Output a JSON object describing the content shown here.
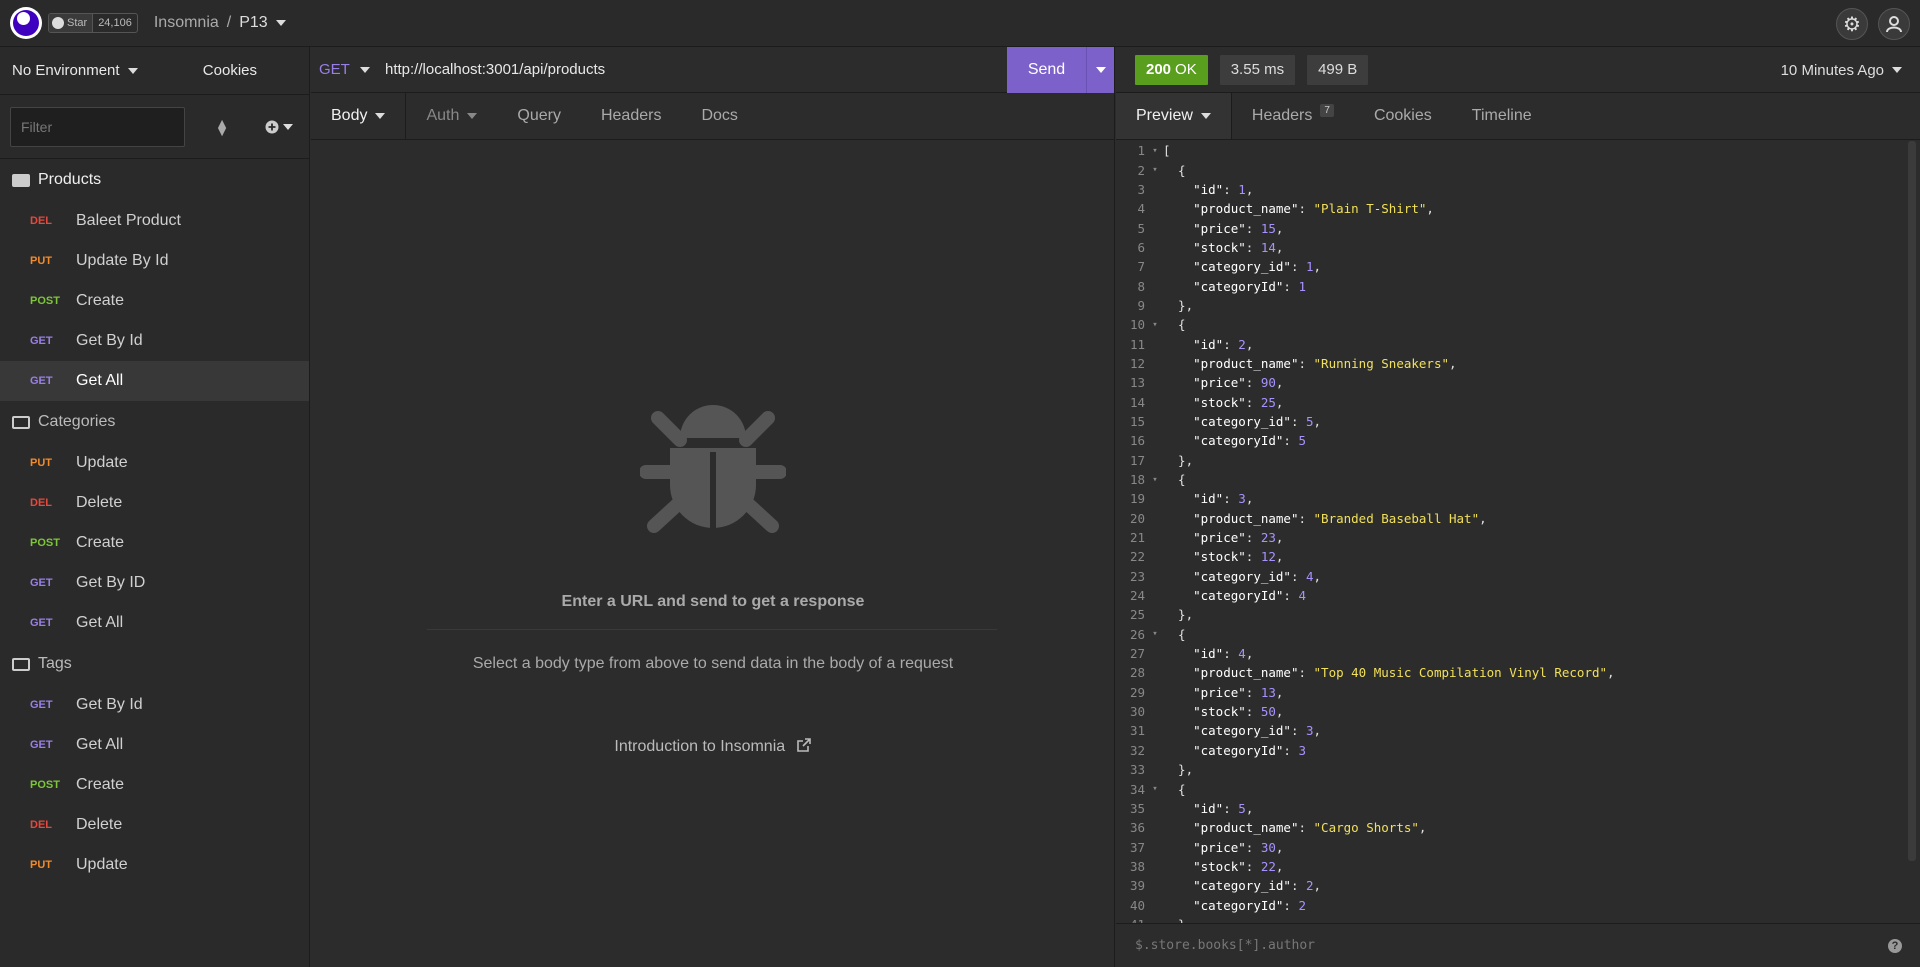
{
  "topbar": {
    "github_star_label": "Star",
    "github_star_count": "24,106",
    "app_name": "Insomnia",
    "separator": "/",
    "project_name": "P13"
  },
  "sidebar": {
    "environment": "No Environment",
    "cookies": "Cookies",
    "filter_placeholder": "Filter",
    "folders": [
      {
        "name": "Products",
        "open": true,
        "requests": [
          {
            "method": "DEL",
            "label": "Baleet Product"
          },
          {
            "method": "PUT",
            "label": "Update By Id"
          },
          {
            "method": "POST",
            "label": "Create"
          },
          {
            "method": "GET",
            "label": "Get By Id"
          },
          {
            "method": "GET",
            "label": "Get All",
            "active": true
          }
        ]
      },
      {
        "name": "Categories",
        "open": false,
        "requests": [
          {
            "method": "PUT",
            "label": "Update"
          },
          {
            "method": "DEL",
            "label": "Delete"
          },
          {
            "method": "POST",
            "label": "Create"
          },
          {
            "method": "GET",
            "label": "Get By ID"
          },
          {
            "method": "GET",
            "label": "Get All"
          }
        ]
      },
      {
        "name": "Tags",
        "open": false,
        "requests": [
          {
            "method": "GET",
            "label": "Get By Id"
          },
          {
            "method": "GET",
            "label": "Get All"
          },
          {
            "method": "POST",
            "label": "Create"
          },
          {
            "method": "DEL",
            "label": "Delete"
          },
          {
            "method": "PUT",
            "label": "Update"
          }
        ]
      }
    ]
  },
  "request": {
    "method": "GET",
    "url": "http://localhost:3001/api/products",
    "send_label": "Send",
    "tabs": [
      "Body",
      "Auth",
      "Query",
      "Headers",
      "Docs"
    ],
    "empty_title": "Enter a URL and send to get a response",
    "empty_subtitle": "Select a body type from above to send data in the body of a request",
    "intro_link": "Introduction to Insomnia"
  },
  "response": {
    "status_code": "200",
    "status_text": "OK",
    "time": "3.55 ms",
    "size": "499 B",
    "time_ago": "10 Minutes Ago",
    "tabs": [
      "Preview",
      "Headers",
      "Cookies",
      "Timeline"
    ],
    "headers_count": "7",
    "query_placeholder": "$.store.books[*].author",
    "products": [
      {
        "id": 1,
        "product_name": "Plain T-Shirt",
        "price": 15,
        "stock": 14,
        "category_id": 1,
        "categoryId": 1
      },
      {
        "id": 2,
        "product_name": "Running Sneakers",
        "price": 90,
        "stock": 25,
        "category_id": 5,
        "categoryId": 5
      },
      {
        "id": 3,
        "product_name": "Branded Baseball Hat",
        "price": 23,
        "stock": 12,
        "category_id": 4,
        "categoryId": 4
      },
      {
        "id": 4,
        "product_name": "Top 40 Music Compilation Vinyl Record",
        "price": 13,
        "stock": 50,
        "category_id": 3,
        "categoryId": 3
      },
      {
        "id": 5,
        "product_name": "Cargo Shorts",
        "price": 30,
        "stock": 22,
        "category_id": 2,
        "categoryId": 2
      }
    ]
  },
  "colors": {
    "accent": "#7b61c9",
    "status_ok": "#5a9e1e",
    "get": "#9a7fe6",
    "post": "#7dc63a",
    "put": "#f28a2a",
    "del": "#e5483c"
  }
}
